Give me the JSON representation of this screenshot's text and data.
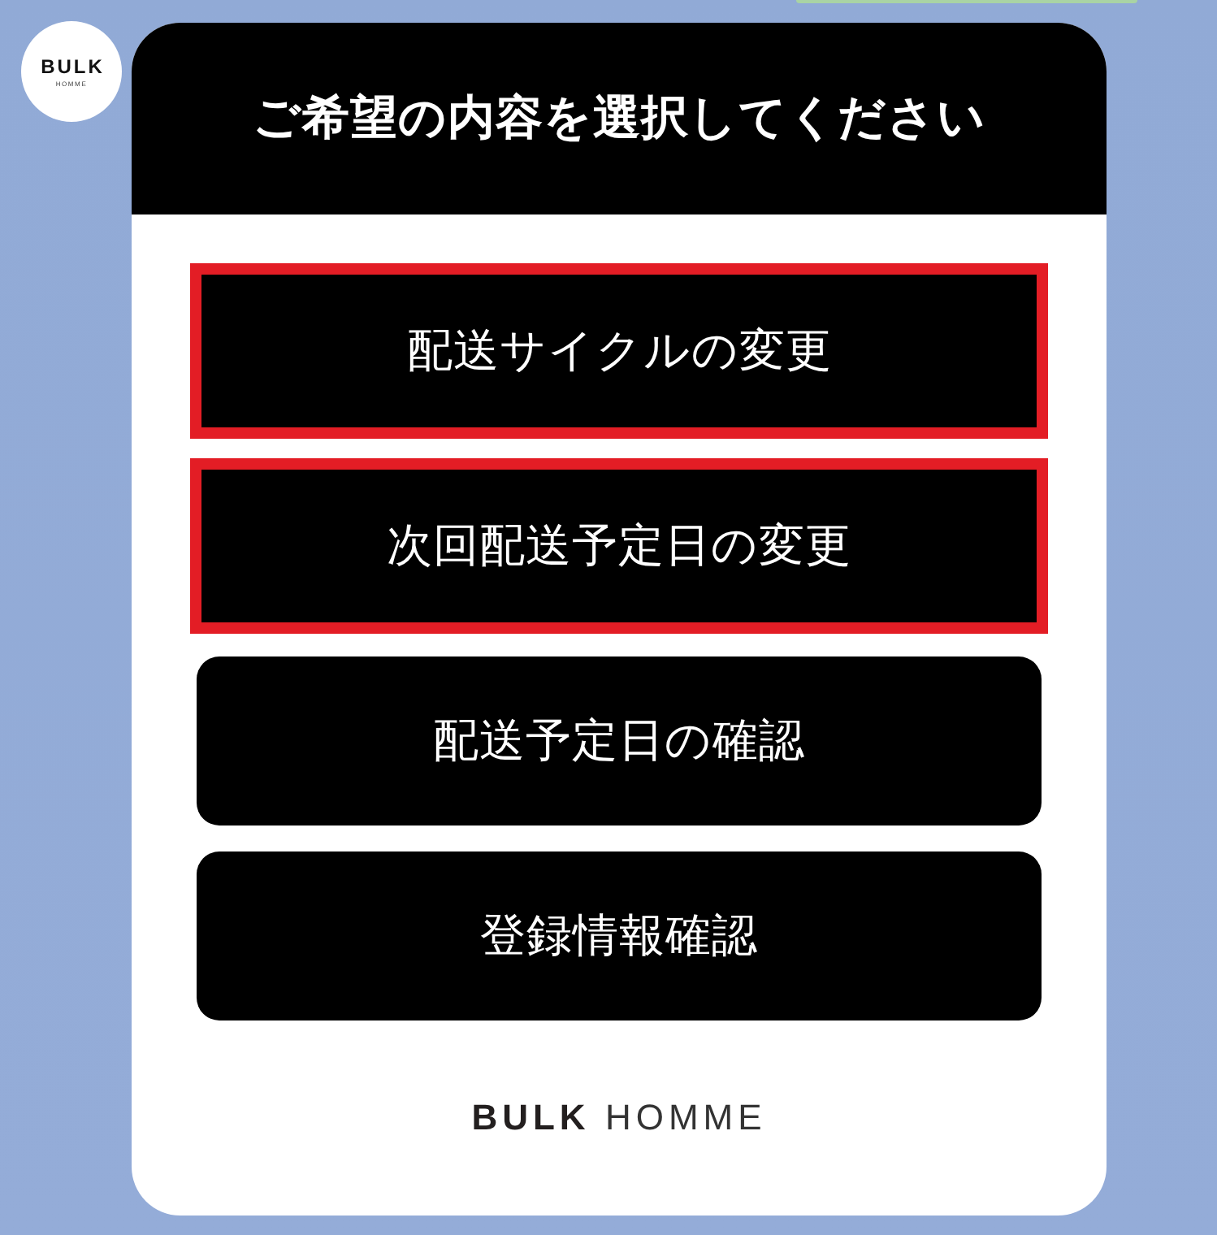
{
  "avatar": {
    "brand": "BULK",
    "subtitle": "HOMME"
  },
  "card": {
    "title": "ご希望の内容を選択してください",
    "options": [
      {
        "label": "配送サイクルの変更",
        "highlighted": true
      },
      {
        "label": "次回配送予定日の変更",
        "highlighted": true
      },
      {
        "label": "配送予定日の確認",
        "highlighted": false
      },
      {
        "label": "登録情報確認",
        "highlighted": false
      }
    ],
    "footer_logo": "**BULK** HOMME"
  }
}
